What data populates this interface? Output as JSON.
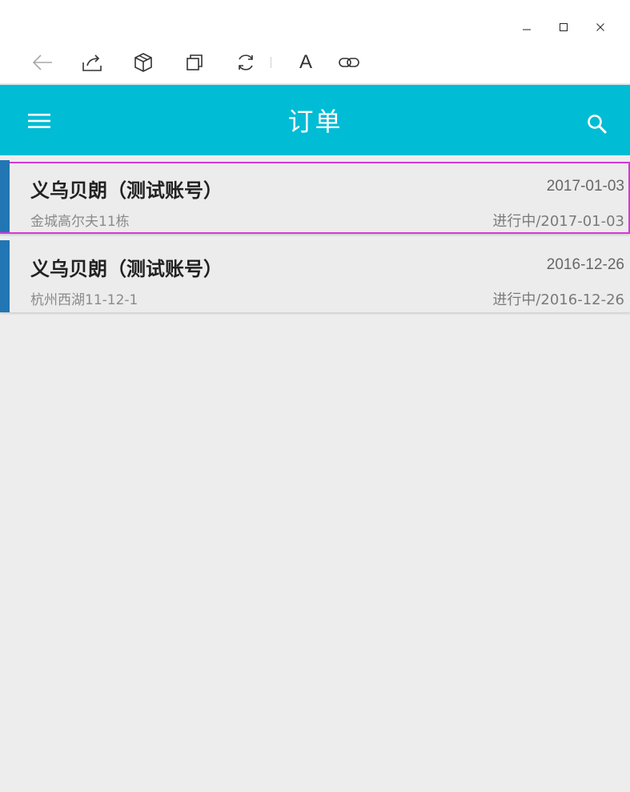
{
  "window": {
    "minimize_icon": "minimize-icon",
    "maximize_icon": "maximize-icon",
    "close_icon": "close-icon"
  },
  "toolbar": {
    "font_label": "A",
    "icons": [
      "back-arrow-icon",
      "share-icon",
      "package-icon",
      "copy-icon",
      "refresh-icon",
      "font-icon",
      "link-icon"
    ]
  },
  "header": {
    "title": "订单",
    "color": "#00bcd4"
  },
  "orders": [
    {
      "name": "义乌贝朗（测试账号）",
      "date": "2017-01-03",
      "address": "金城高尔夫11栋",
      "status": "进行中/2017-01-03",
      "accent_color": "#2276b4"
    },
    {
      "name": "义乌贝朗（测试账号）",
      "date": "2016-12-26",
      "address": "杭州西湖11-12-1",
      "status": "进行中/2016-12-26",
      "accent_color": "#2276b4"
    }
  ],
  "colors": {
    "accent": "#00bcd4",
    "list_accent": "#2276b4",
    "selection_outline": "#d23ad8",
    "background": "#ededed"
  }
}
